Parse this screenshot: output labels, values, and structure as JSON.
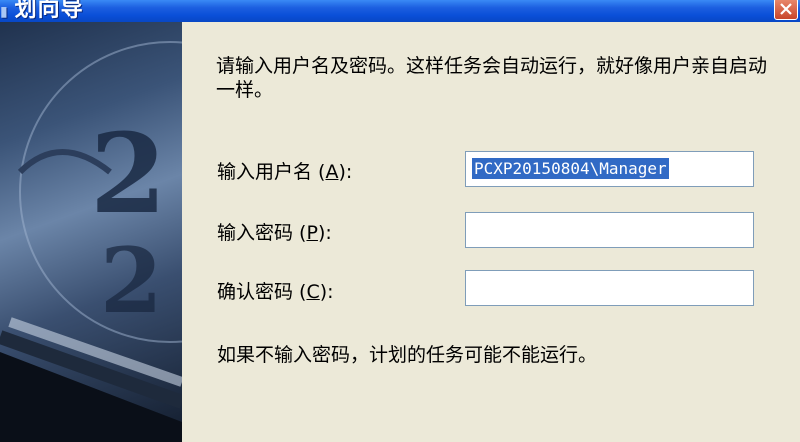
{
  "window": {
    "title": "划向导",
    "close_icon": "close-icon"
  },
  "instruction": "请输入用户名及密码。这样任务会自动运行，就好像用户亲自启动一样。",
  "fields": {
    "username": {
      "label": "输入用户名",
      "accel": "A",
      "value": "PCXP20150804\\Manager"
    },
    "password": {
      "label": "输入密码",
      "accel": "P",
      "value": ""
    },
    "confirm": {
      "label": "确认密码",
      "accel": "C",
      "value": ""
    }
  },
  "note": "如果不输入密码，计划的任务可能不能运行。",
  "colors": {
    "titlebar": "#0A4FD8",
    "dialog_bg": "#ECE9D8",
    "selection": "#316AC5",
    "input_border": "#7F9DB9"
  }
}
